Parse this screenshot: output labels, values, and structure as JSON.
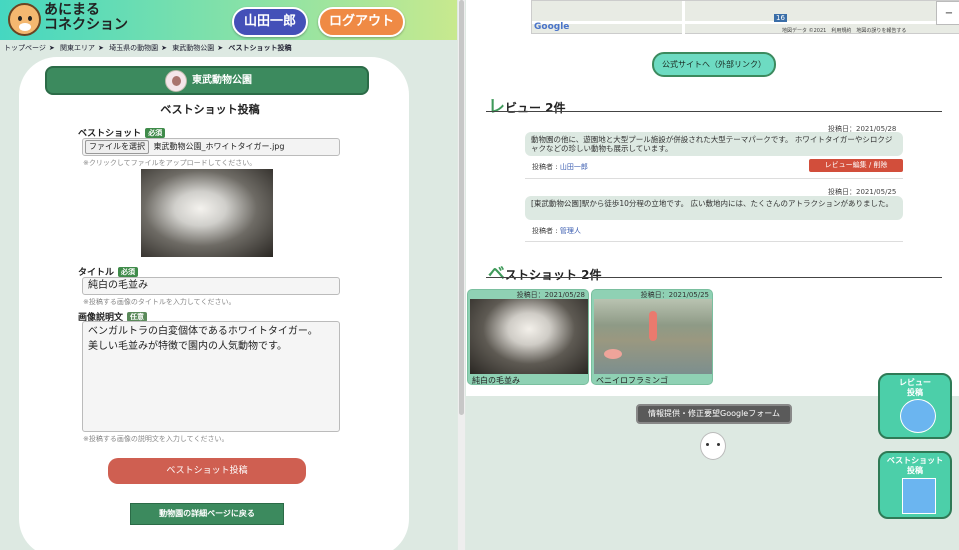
{
  "header": {
    "logo_text_line1": "あにまる",
    "logo_text_line2": "コネクション",
    "user_button": "山田一郎",
    "logout_button": "ログアウト"
  },
  "breadcrumb": [
    "トップページ",
    "関東エリア",
    "埼玉県の動物園",
    "東武動物公園",
    "ベストショット投稿"
  ],
  "breadcrumb_sep": "➤",
  "zoo": {
    "name": "東武動物公園"
  },
  "form": {
    "title": "ベストショット投稿",
    "required_badge": "必須",
    "optional_badge": "任意",
    "bestshot_label": "ベストショット",
    "file_button": "ファイルを選択",
    "file_name": "東武動物公園_ホワイトタイガー.jpg",
    "file_hint": "※クリックしてファイルをアップロードしてください。",
    "title_label": "タイトル",
    "title_value": "純白の毛並み",
    "title_hint": "※投稿する画像のタイトルを入力してください。",
    "desc_label": "画像説明文",
    "desc_value": "ベンガルトラの白変個体であるホワイトタイガー。\n美しい毛並みが特徴で園内の人気動物です。",
    "desc_hint": "※投稿する画像の説明文を入力してください。",
    "submit_button": "ベストショット投稿",
    "back_button": "動物園の詳細ページに戻る"
  },
  "map": {
    "route_label": "16",
    "google_logo": "Google",
    "credit": "地図データ ©2021　利用規約　地図の誤りを報告する",
    "zoom_out": "−"
  },
  "official_site_button": "公式サイトへ（外部リンク）",
  "reviews": {
    "heading_initial": "レ",
    "heading_rest": "ビュー 2件",
    "items": [
      {
        "date": "投稿日：2021/05/28",
        "text": "動物園の他に、遊園地と大型プール施設が併設された大型テーマパークです。\nホワイトタイガーやシロクジャクなどの珍しい動物も展示しています。",
        "author_prefix": "投稿者 :",
        "author": "山田一郎",
        "edit_button": "レビュー編集 / 削除"
      },
      {
        "date": "投稿日：2021/05/25",
        "text": "[東武動物公園]駅から徒歩10分程の立地です。\n広い敷地内には、たくさんのアトラクションがありました。",
        "author_prefix": "投稿者 :",
        "author": "管理人"
      }
    ]
  },
  "bestshots": {
    "heading_initial": "ベ",
    "heading_rest": "ストショット 2件",
    "items": [
      {
        "date": "投稿日：2021/05/28",
        "title": "純白の毛並み"
      },
      {
        "date": "投稿日：2021/05/25",
        "title": "ベニイロフラミンゴ"
      }
    ]
  },
  "google_form_button": "情報提供・修正要望Googleフォーム",
  "fab": {
    "review_line1": "レビュー",
    "review_line2": "投稿",
    "photo_line1": "ベストショット",
    "photo_line2": "投稿"
  }
}
